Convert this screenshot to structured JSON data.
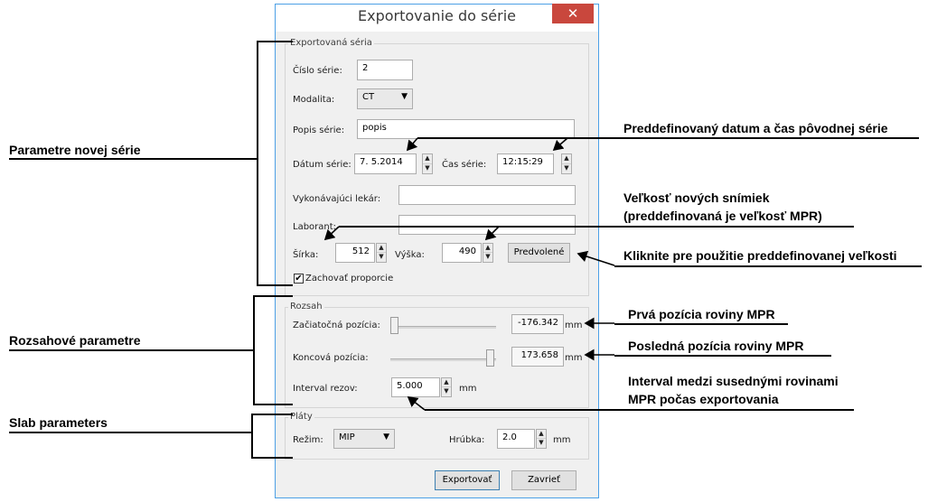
{
  "window": {
    "title": "Exportovanie do série",
    "close_glyph": "✕"
  },
  "series_group": {
    "label": "Exportovaná séria",
    "series_number_label": "Číslo série:",
    "series_number_value": "2",
    "modality_label": "Modalita:",
    "modality_value": "CT",
    "description_label": "Popis série:",
    "description_value": "popis",
    "date_label": "Dátum série:",
    "date_value": "7.  5.2014",
    "time_label": "Čas série:",
    "time_value": "12:15:29",
    "physician_label": "Vykonávajúci lekár:",
    "physician_value": "",
    "technician_label": "Laborant:",
    "technician_value": "",
    "width_label": "Šírka:",
    "width_value": "512",
    "height_label": "Výška:",
    "height_value": "490",
    "default_button": "Predvolené",
    "keep_ratio_label": "Zachovať proporcie",
    "keep_ratio_checked": true
  },
  "range_group": {
    "label": "Rozsah",
    "start_label": "Začiatočná pozícia:",
    "start_value": "-176.342",
    "start_slider_fraction": 0.0,
    "end_label": "Koncová pozícia:",
    "end_value": "173.658",
    "end_slider_fraction": 1.0,
    "unit": "mm",
    "interval_label": "Interval rezov:",
    "interval_value": "5.000",
    "interval_unit": "mm"
  },
  "slab_group": {
    "label": "Pláty",
    "mode_label": "Režim:",
    "mode_value": "MIP",
    "thickness_label": "Hrúbka:",
    "thickness_value": "2.0",
    "thickness_unit": "mm"
  },
  "footer": {
    "export_button": "Exportovať",
    "close_button": "Zavrieť"
  },
  "annotations": {
    "new_series_params": "Parametre novej série",
    "range_params": "Rozsahové parametre",
    "slab_params": "Slab parameters",
    "predefined_datetime": "Preddefinovaný datum a čas pôvodnej série",
    "image_size_line1": "Veľkosť nových snímiek",
    "image_size_line2": "(preddefinovaná je veľkosť MPR)",
    "click_default": "Kliknite pre použitie preddefinovanej veľkosti",
    "first_position": "Prvá pozícia roviny MPR",
    "last_position": "Posledná pozícia roviny MPR",
    "interval_line1": "Interval medzi susednými rovinami",
    "interval_line2": "MPR počas exportovania"
  },
  "colors": {
    "title_border": "#4ca0e6",
    "close_button": "#c9473d",
    "dialog_bg": "#f0f0f0"
  }
}
